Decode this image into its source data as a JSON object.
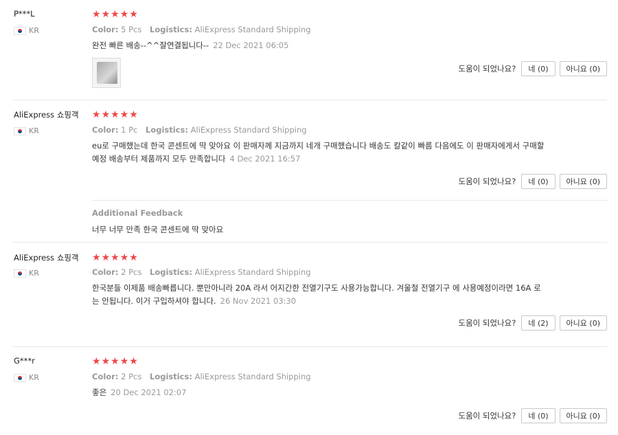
{
  "labels": {
    "color": "Color:",
    "logistics": "Logistics:",
    "helpful_question": "도움이 되었나요?",
    "yes": "네",
    "no": "아니요",
    "additional_feedback": "Additional Feedback"
  },
  "reviews": [
    {
      "user": "P***L",
      "country": "KR",
      "rating": 5,
      "color": "5 Pcs",
      "logistics": "AliExpress Standard Shipping",
      "text": "완전 빠른 배송--^^잘연결됩니다--",
      "date": "22 Dec 2021 06:05",
      "yes": "(0)",
      "no": "(0)"
    },
    {
      "user": "AliExpress 쇼핑객",
      "country": "KR",
      "rating": 5,
      "color": "1 Pc",
      "logistics": "AliExpress Standard Shipping",
      "text": "eu로 구매했는데 한국 콘센트에 딱 맞아요 이 판매자께 지금까지 네개 구매했습니다 배송도 칼같이 빠름 다음에도 이 판매자에게서 구매할 예정 배송부터 제품까지 모두 만족합니다",
      "date": "4 Dec 2021 16:57",
      "yes": "(0)",
      "no": "(0)",
      "additional_text": "너무 너무 만족 한국 콘센트에 딱 맞아요"
    },
    {
      "user": "AliExpress 쇼핑객",
      "country": "KR",
      "rating": 5,
      "color": "2 Pcs",
      "logistics": "AliExpress Standard Shipping",
      "text": "한국분들 이제품 배송빠릅니다. 뿐만아니라 20A 라서 어지간한 전열기구도 사용가능합니다. 겨울철 전열기구 에 사용예정이라면 16A 로는 안됩니다. 이거 구입하셔야 합니다.",
      "date": "26 Nov 2021 03:30",
      "yes": "(2)",
      "no": "(0)"
    },
    {
      "user": "G***r",
      "country": "KR",
      "rating": 5,
      "color": "2 Pcs",
      "logistics": "AliExpress Standard Shipping",
      "text": "좋은",
      "date": "20 Dec 2021 02:07",
      "yes": "(0)",
      "no": "(0)"
    }
  ]
}
